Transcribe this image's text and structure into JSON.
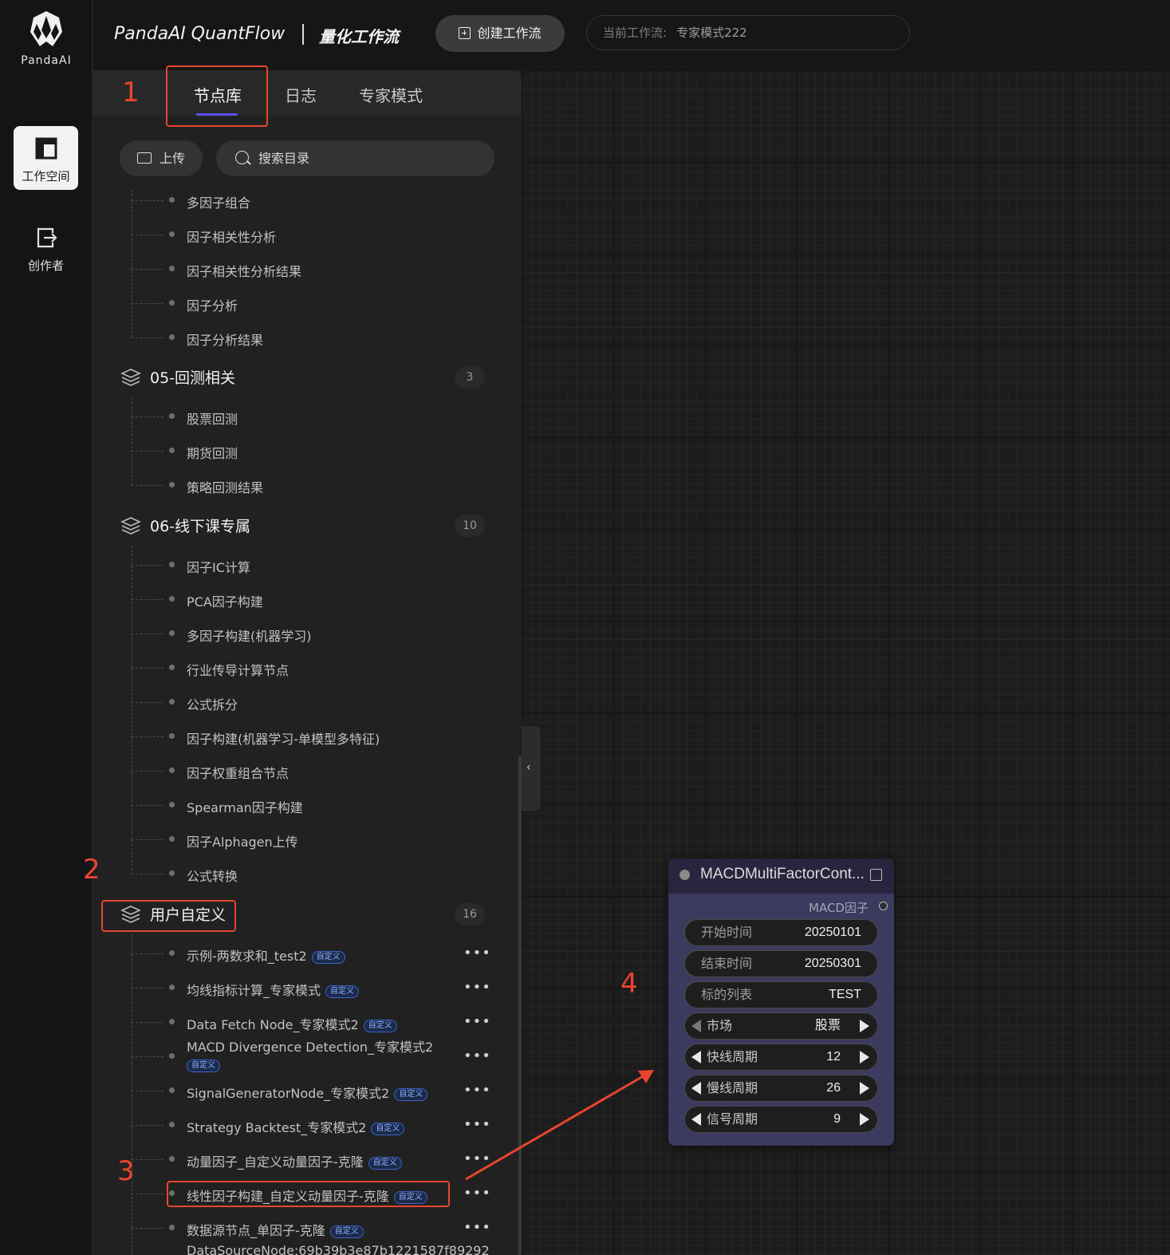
{
  "rail": {
    "brand": "PandaAI",
    "items": [
      {
        "label": "工作空间",
        "icon": "layout-icon"
      },
      {
        "label": "创作者",
        "icon": "exit-icon"
      }
    ]
  },
  "topbar": {
    "title": "PandaAI QuantFlow",
    "subtitle": "量化工作流",
    "create_button": "创建工作流",
    "current_workflow_label": "当前工作流:",
    "current_workflow_value": "专家模式222"
  },
  "panel": {
    "tabs": [
      "节点库",
      "日志",
      "专家模式"
    ],
    "active_tab": "节点库",
    "upload_label": "上传",
    "search_placeholder": "搜索目录",
    "top_items": [
      "多因子组合",
      "因子相关性分析",
      "因子相关性分析结果",
      "因子分析",
      "因子分析结果"
    ],
    "groups": [
      {
        "title": "05-回测相关",
        "count": "3",
        "items": [
          "股票回测",
          "期货回测",
          "策略回测结果"
        ]
      },
      {
        "title": "06-线下课专属",
        "count": "10",
        "items": [
          "因子IC计算",
          "PCA因子构建",
          "多因子构建(机器学习)",
          "行业传导计算节点",
          "公式拆分",
          "因子构建(机器学习-单模型多特征)",
          "因子权重组合节点",
          "Spearman因子构建",
          "因子Alphagen上传",
          "公式转换"
        ]
      },
      {
        "title": "用户自定义",
        "count": "16",
        "items": [
          "示例-两数求和_test2",
          "均线指标计算_专家模式",
          "Data Fetch Node_专家模式2",
          "MACD Divergence Detection_专家模式2",
          "SignalGeneratorNode_专家模式2",
          "Strategy Backtest_专家模式2",
          "动量因子_自定义动量因子-克隆",
          "线性因子构建_自定义动量因子-克隆",
          "数据源节点_单因子-克隆",
          "DataSourceNode:69b39b3e87b1221587f89292"
        ]
      }
    ],
    "custom_badge": "自定义"
  },
  "annotations": [
    "1",
    "2",
    "3",
    "4"
  ],
  "annotation_color": "#e8452e",
  "node": {
    "title": "MACDMultiFactorCont...",
    "output_label": "MACD因子",
    "fields": [
      {
        "label": "开始时间",
        "value": "20250101"
      },
      {
        "label": "结束时间",
        "value": "20250301"
      },
      {
        "label": "标的列表",
        "value": "TEST"
      }
    ],
    "combos": [
      {
        "label": "市场",
        "value": "股票"
      },
      {
        "label": "快线周期",
        "value": "12"
      },
      {
        "label": "慢线周期",
        "value": "26"
      },
      {
        "label": "信号周期",
        "value": "9"
      }
    ]
  }
}
